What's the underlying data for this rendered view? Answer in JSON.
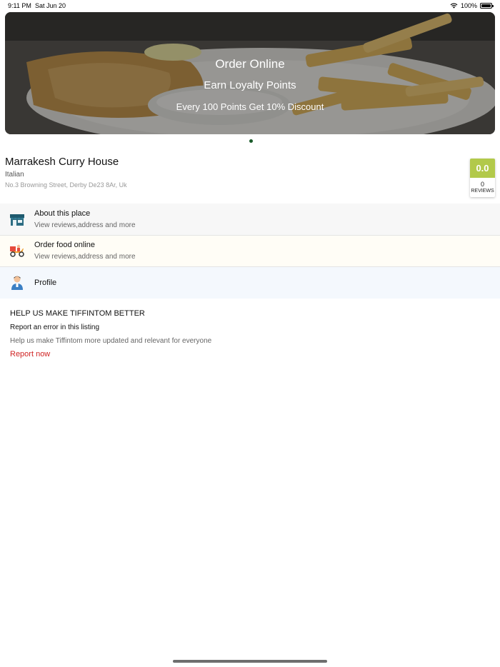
{
  "status_bar": {
    "time": "9:11 PM",
    "date": "Sat Jun 20",
    "battery": "100%"
  },
  "banner": {
    "title": "Order Online",
    "subtitle": "Earn Loyalty Points",
    "promo": "Every 100 Points Get 10% Discount"
  },
  "restaurant": {
    "name": "Marrakesh Curry House",
    "cuisine": "Italian",
    "address": "No.3 Browning Street, Derby De23 8Ar, Uk",
    "rating": "0.0",
    "review_count": "0",
    "review_label": "REVIEWS",
    "rating_color": "#b2c94a"
  },
  "menu": {
    "about": {
      "title": "About this place",
      "subtitle": "View reviews,address and more",
      "icon": "store-icon"
    },
    "order": {
      "title": "Order food online",
      "subtitle": "View reviews,address and more",
      "icon": "delivery-scooter-icon"
    },
    "profile": {
      "title": "Profile",
      "icon": "person-icon"
    }
  },
  "help": {
    "title": "HELP US MAKE TIFFINTOM BETTER",
    "report_heading": "Report an error in this listing",
    "description": "Help us make Tiffintom more updated and relevant for everyone",
    "link": "Report now",
    "link_color": "#d02424"
  }
}
